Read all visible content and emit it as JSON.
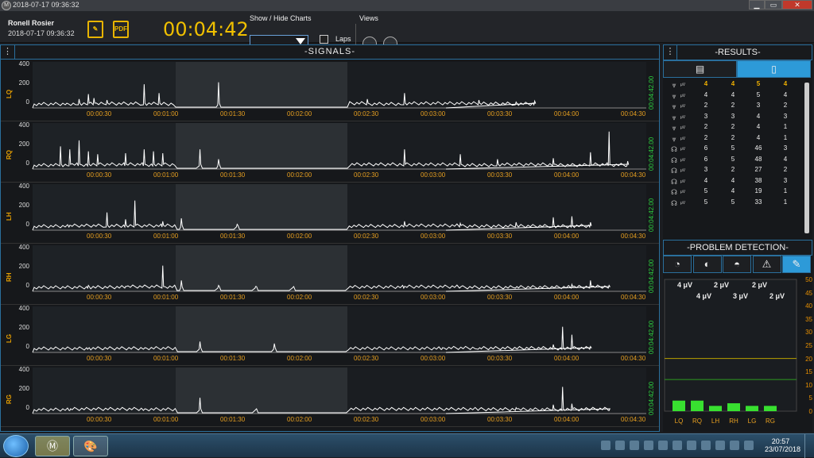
{
  "window": {
    "title": "2018-07-17 09:36:32",
    "min": "▁",
    "max": "▭",
    "close": "✕"
  },
  "toolbar": {
    "user": "Ronell  Rosier",
    "date": "2018-07-17 09:36:32",
    "report_icon": "report-icon",
    "pdf_label": "PDF",
    "timer": "00:04:42",
    "show_hide_label": "Show / Hide Charts",
    "laps_label": "Laps",
    "views_label": "Views"
  },
  "signals": {
    "title": "-SIGNALS-",
    "menu": "⋮",
    "duration": "00:04:42.00",
    "y_ticks": [
      "400",
      "200",
      "0"
    ],
    "x_ticks": [
      "00:00:30",
      "00:01:00",
      "00:01:30",
      "00:02:00",
      "00:02:30",
      "00:03:00",
      "00:03:30",
      "00:04:00",
      "00:04:30"
    ],
    "charts": [
      {
        "label": "LQ",
        "peaks": [
          [
            18,
            40
          ],
          [
            25,
            90
          ],
          [
            30,
            140
          ],
          [
            33,
            100
          ],
          [
            40,
            80
          ],
          [
            60,
            240
          ],
          [
            68,
            150
          ],
          [
            100,
            260
          ],
          [
            180,
            90
          ],
          [
            200,
            150
          ],
          [
            240,
            80
          ],
          [
            260,
            60
          ],
          [
            270,
            70
          ]
        ]
      },
      {
        "label": "RQ",
        "peaks": [
          [
            15,
            230
          ],
          [
            20,
            200
          ],
          [
            25,
            290
          ],
          [
            30,
            180
          ],
          [
            35,
            150
          ],
          [
            50,
            160
          ],
          [
            60,
            200
          ],
          [
            65,
            180
          ],
          [
            70,
            160
          ],
          [
            90,
            200
          ],
          [
            100,
            100
          ],
          [
            200,
            200
          ],
          [
            230,
            150
          ],
          [
            250,
            100
          ],
          [
            280,
            110
          ],
          [
            300,
            170
          ],
          [
            310,
            380
          ],
          [
            320,
            80
          ]
        ]
      },
      {
        "label": "LH",
        "peaks": [
          [
            20,
            50
          ],
          [
            40,
            180
          ],
          [
            50,
            110
          ],
          [
            55,
            300
          ],
          [
            70,
            90
          ],
          [
            80,
            120
          ],
          [
            110,
            60
          ],
          [
            200,
            90
          ],
          [
            230,
            70
          ],
          [
            260,
            80
          ],
          [
            280,
            130
          ],
          [
            290,
            140
          ],
          [
            300,
            80
          ]
        ]
      },
      {
        "label": "RH",
        "peaks": [
          [
            30,
            60
          ],
          [
            50,
            50
          ],
          [
            70,
            260
          ],
          [
            80,
            110
          ],
          [
            100,
            60
          ],
          [
            120,
            50
          ],
          [
            140,
            40
          ],
          [
            200,
            50
          ],
          [
            230,
            40
          ],
          [
            260,
            40
          ],
          [
            290,
            70
          ],
          [
            300,
            110
          ],
          [
            310,
            60
          ]
        ]
      },
      {
        "label": "LG",
        "peaks": [
          [
            30,
            40
          ],
          [
            60,
            40
          ],
          [
            90,
            110
          ],
          [
            130,
            90
          ],
          [
            220,
            30
          ],
          [
            240,
            40
          ],
          [
            280,
            80
          ],
          [
            285,
            260
          ],
          [
            290,
            180
          ],
          [
            300,
            60
          ]
        ]
      },
      {
        "label": "RG",
        "peaks": [
          [
            20,
            30
          ],
          [
            60,
            40
          ],
          [
            90,
            160
          ],
          [
            120,
            40
          ],
          [
            240,
            40
          ],
          [
            260,
            60
          ],
          [
            280,
            90
          ],
          [
            285,
            270
          ],
          [
            290,
            100
          ],
          [
            300,
            40
          ],
          [
            310,
            30
          ]
        ]
      }
    ]
  },
  "results": {
    "title": "-RESULTS-",
    "menu": "⋮",
    "tab_doc_icon": "document-icon",
    "tab_page_icon": "page-icon",
    "unit": "μV",
    "rows": [
      {
        "icon": "chevrons-down-icon",
        "vals": [
          "4",
          "4",
          "5",
          "4"
        ],
        "highlight": true
      },
      {
        "icon": "chevrons-down-icon",
        "vals": [
          "4",
          "4",
          "5",
          "4"
        ]
      },
      {
        "icon": "chevrons-down-icon",
        "vals": [
          "2",
          "2",
          "3",
          "2"
        ]
      },
      {
        "icon": "chevrons-down-icon",
        "vals": [
          "3",
          "3",
          "4",
          "3"
        ]
      },
      {
        "icon": "chevrons-down-icon",
        "vals": [
          "2",
          "2",
          "4",
          "1"
        ]
      },
      {
        "icon": "chevrons-down-icon",
        "vals": [
          "2",
          "2",
          "4",
          "1"
        ]
      },
      {
        "icon": "stethoscope-icon",
        "vals": [
          "6",
          "5",
          "46",
          "3"
        ]
      },
      {
        "icon": "stethoscope-icon",
        "vals": [
          "6",
          "5",
          "48",
          "4"
        ]
      },
      {
        "icon": "stethoscope-icon",
        "vals": [
          "3",
          "2",
          "27",
          "2"
        ]
      },
      {
        "icon": "stethoscope-icon",
        "vals": [
          "4",
          "4",
          "38",
          "3"
        ]
      },
      {
        "icon": "stethoscope-icon",
        "vals": [
          "5",
          "4",
          "19",
          "1"
        ]
      },
      {
        "icon": "stethoscope-icon",
        "vals": [
          "5",
          "5",
          "33",
          "1"
        ]
      }
    ]
  },
  "problem": {
    "title": "-PROBLEM DETECTION-",
    "tabs": [
      "◔",
      "◐",
      "◓",
      "⚠",
      "✎"
    ],
    "value_labels": [
      "4 μV",
      "4 μV",
      "2 μV",
      "3 μV",
      "2 μV",
      "2 μV"
    ],
    "y_ticks": [
      "50",
      "45",
      "40",
      "35",
      "30",
      "25",
      "20",
      "15",
      "10",
      "5",
      "0"
    ],
    "line_green": 12,
    "line_yellow": 20,
    "colors": {
      "bar": "#38e030",
      "accent": "#2d9ad8"
    }
  },
  "chart_data": {
    "type": "bar",
    "categories": [
      "LQ",
      "RQ",
      "LH",
      "RH",
      "LG",
      "RG"
    ],
    "values": [
      4,
      4,
      2,
      3,
      2,
      2
    ],
    "ylim": [
      0,
      50
    ]
  },
  "taskbar": {
    "time": "20:57",
    "date": "23/07/2018"
  }
}
